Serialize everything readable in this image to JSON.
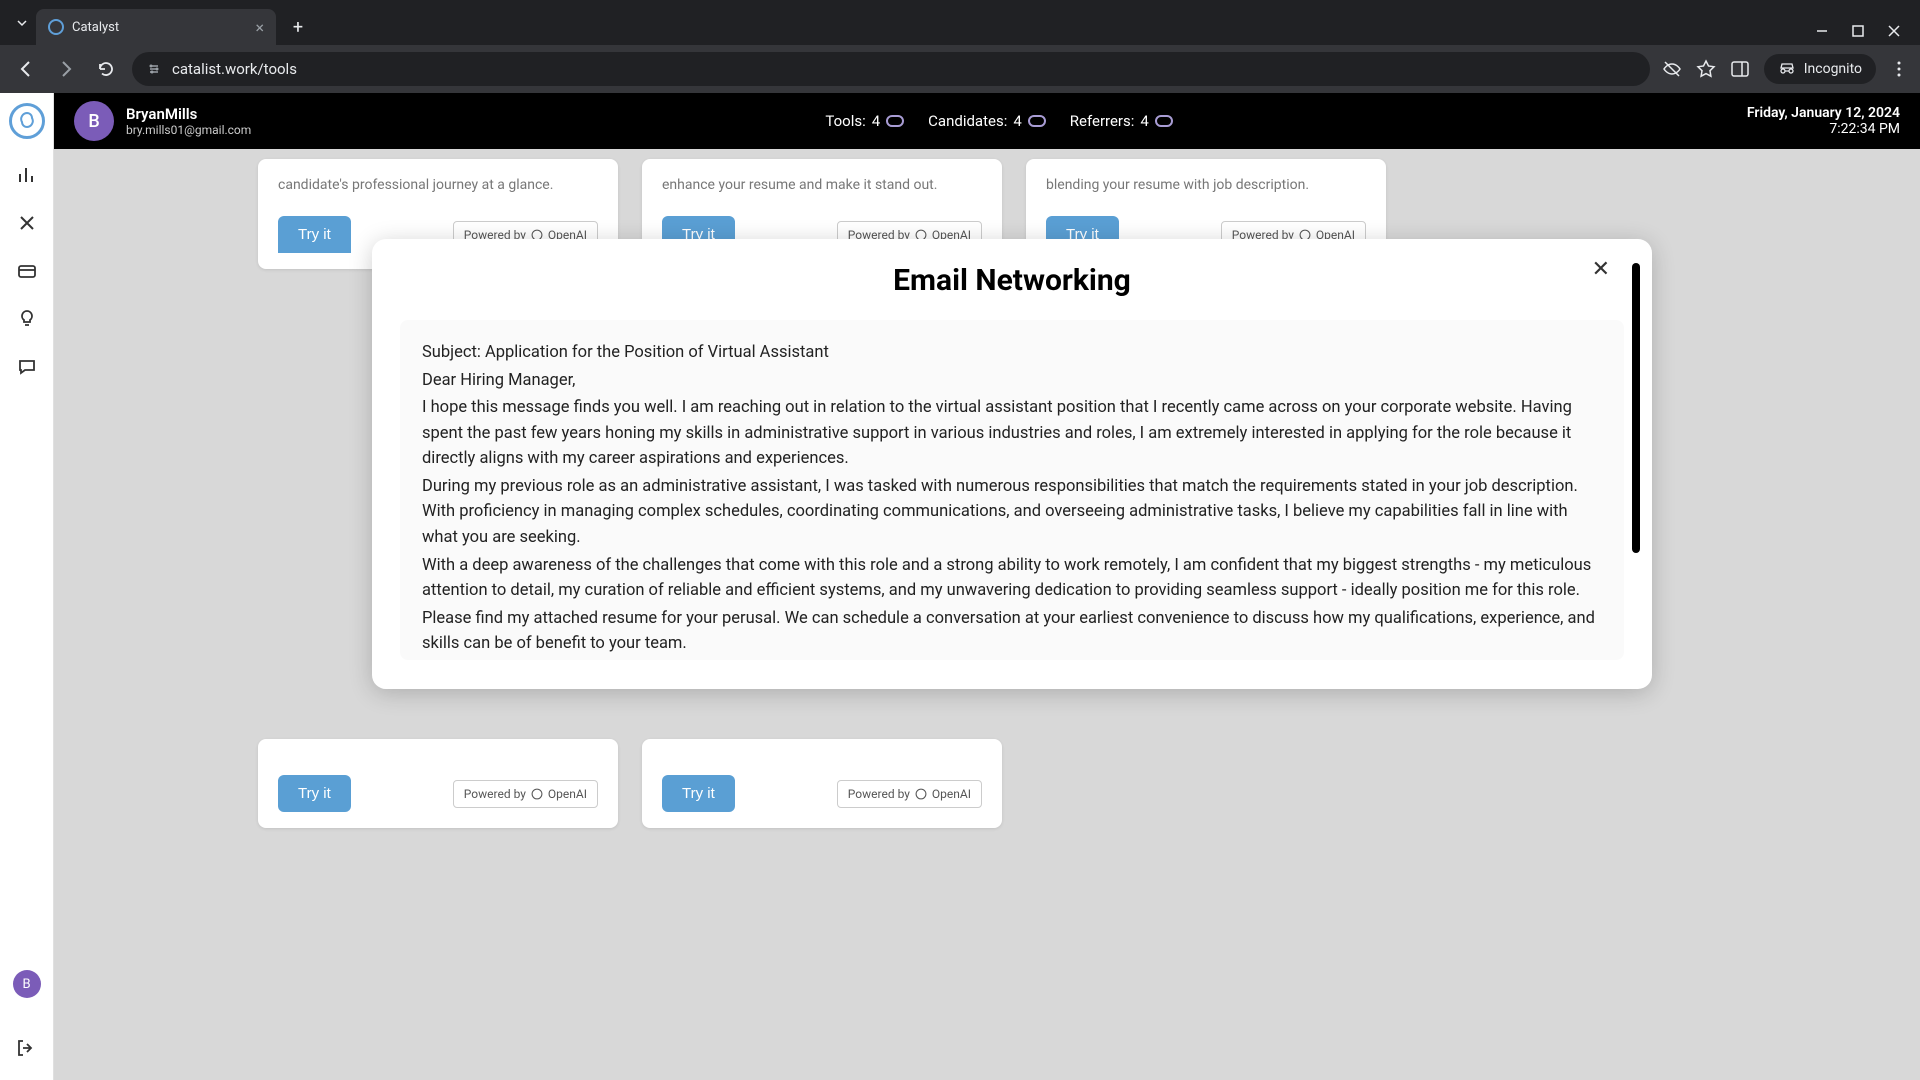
{
  "browser": {
    "tab_title": "Catalyst",
    "url": "catalist.work/tools",
    "incognito_label": "Incognito"
  },
  "topbar": {
    "user_initial": "B",
    "user_name": "BryanMills",
    "user_email": "bry.mills01@gmail.com",
    "stats": [
      {
        "label": "Tools:",
        "value": "4"
      },
      {
        "label": "Candidates:",
        "value": "4"
      },
      {
        "label": "Referrers:",
        "value": "4"
      }
    ],
    "date": "Friday, January 12, 2024",
    "time": "7:22:34 PM"
  },
  "cards_upper": [
    {
      "desc": "candidate's professional journey at a glance."
    },
    {
      "desc": "enhance your resume and make it stand out."
    },
    {
      "desc": "blending your resume with job description."
    }
  ],
  "cards_lower": [
    {
      "desc": ""
    },
    {
      "desc": ""
    }
  ],
  "try_label": "Try it",
  "powered_label": "Powered by",
  "openai_label": "OpenAI",
  "modal": {
    "title": "Email Networking",
    "subject": "Subject: Application for the Position of Virtual Assistant",
    "greeting": "Dear Hiring Manager,",
    "p1": "I hope this message finds you well. I am reaching out in relation to the virtual assistant position that I recently came across on your corporate website. Having spent the past few years honing my skills in administrative support in various industries and roles, I am extremely interested in applying for the role because it directly aligns with my career aspirations and experiences.",
    "p2": "During my previous role as an administrative assistant, I was tasked with numerous responsibilities that match the requirements stated in your job description. With proficiency in managing complex schedules, coordinating communications, and overseeing administrative tasks, I believe my capabilities fall in line with what you are seeking.",
    "p3": "With a deep awareness of the challenges that come with this role and a strong ability to work remotely, I am confident that my biggest strengths - my meticulous attention to detail, my curation of reliable and efficient systems, and my unwavering dedication to providing seamless support - ideally position me for this role.",
    "p4": "Please find my attached resume for your perusal. We can schedule a conversation at your earliest convenience to discuss how my qualifications, experience, and skills can be of benefit to your team."
  },
  "rail_avatar_initial": "B"
}
